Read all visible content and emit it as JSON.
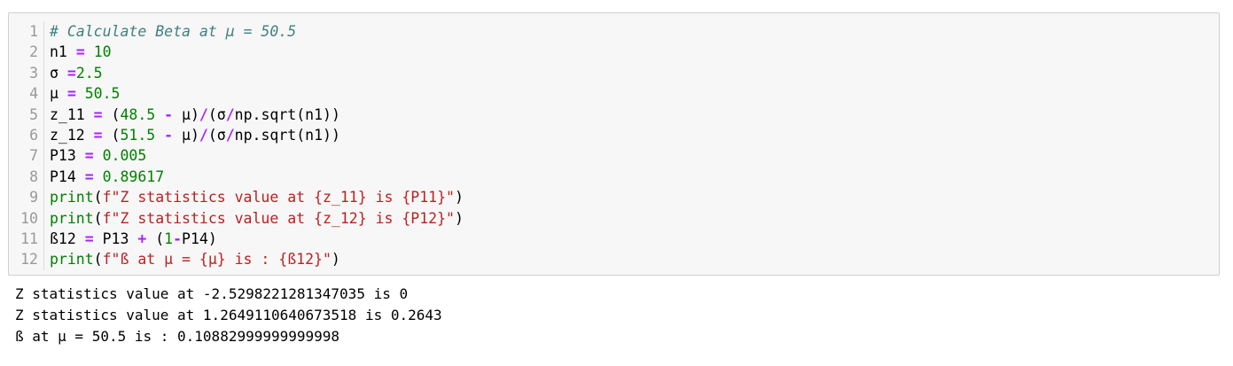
{
  "cell": {
    "lines": [
      {
        "n": "1",
        "tokens": [
          {
            "t": "# Calculate Beta at μ = 50.5",
            "k": "comment"
          }
        ]
      },
      {
        "n": "2",
        "tokens": [
          {
            "t": "n1 ",
            "k": "var"
          },
          {
            "t": "=",
            "k": "op"
          },
          {
            "t": " ",
            "k": "var"
          },
          {
            "t": "10",
            "k": "num"
          }
        ]
      },
      {
        "n": "3",
        "tokens": [
          {
            "t": "σ ",
            "k": "var"
          },
          {
            "t": "=",
            "k": "op"
          },
          {
            "t": "2.5",
            "k": "num"
          }
        ]
      },
      {
        "n": "4",
        "tokens": [
          {
            "t": "μ ",
            "k": "var"
          },
          {
            "t": "=",
            "k": "op"
          },
          {
            "t": " ",
            "k": "var"
          },
          {
            "t": "50.5",
            "k": "num"
          }
        ]
      },
      {
        "n": "5",
        "tokens": [
          {
            "t": "z_11 ",
            "k": "var"
          },
          {
            "t": "=",
            "k": "op"
          },
          {
            "t": " (",
            "k": "var"
          },
          {
            "t": "48.5",
            "k": "num"
          },
          {
            "t": " ",
            "k": "var"
          },
          {
            "t": "-",
            "k": "op"
          },
          {
            "t": " μ)",
            "k": "var"
          },
          {
            "t": "/",
            "k": "op"
          },
          {
            "t": "(σ",
            "k": "var"
          },
          {
            "t": "/",
            "k": "op"
          },
          {
            "t": "np",
            "k": "var"
          },
          {
            "t": ".",
            "k": "var"
          },
          {
            "t": "sqrt(n1))",
            "k": "var"
          }
        ]
      },
      {
        "n": "6",
        "tokens": [
          {
            "t": "z_12 ",
            "k": "var"
          },
          {
            "t": "=",
            "k": "op"
          },
          {
            "t": " (",
            "k": "var"
          },
          {
            "t": "51.5",
            "k": "num"
          },
          {
            "t": " ",
            "k": "var"
          },
          {
            "t": "-",
            "k": "op"
          },
          {
            "t": " μ)",
            "k": "var"
          },
          {
            "t": "/",
            "k": "op"
          },
          {
            "t": "(σ",
            "k": "var"
          },
          {
            "t": "/",
            "k": "op"
          },
          {
            "t": "np",
            "k": "var"
          },
          {
            "t": ".",
            "k": "var"
          },
          {
            "t": "sqrt(n1))",
            "k": "var"
          }
        ]
      },
      {
        "n": "7",
        "tokens": [
          {
            "t": "P13 ",
            "k": "var"
          },
          {
            "t": "=",
            "k": "op"
          },
          {
            "t": " ",
            "k": "var"
          },
          {
            "t": "0.005",
            "k": "num"
          }
        ]
      },
      {
        "n": "8",
        "tokens": [
          {
            "t": "P14 ",
            "k": "var"
          },
          {
            "t": "=",
            "k": "op"
          },
          {
            "t": " ",
            "k": "var"
          },
          {
            "t": "0.89617",
            "k": "num"
          }
        ]
      },
      {
        "n": "9",
        "tokens": [
          {
            "t": "print",
            "k": "builtin"
          },
          {
            "t": "(",
            "k": "var"
          },
          {
            "t": "f\"Z statistics value at {z_11} is {P11}\"",
            "k": "str"
          },
          {
            "t": ")",
            "k": "var"
          }
        ]
      },
      {
        "n": "10",
        "tokens": [
          {
            "t": "print",
            "k": "builtin"
          },
          {
            "t": "(",
            "k": "var"
          },
          {
            "t": "f\"Z statistics value at {z_12} is {P12}\"",
            "k": "str"
          },
          {
            "t": ")",
            "k": "var"
          }
        ]
      },
      {
        "n": "11",
        "tokens": [
          {
            "t": "ß12 ",
            "k": "var"
          },
          {
            "t": "=",
            "k": "op"
          },
          {
            "t": " P13 ",
            "k": "var"
          },
          {
            "t": "+",
            "k": "op"
          },
          {
            "t": " (",
            "k": "var"
          },
          {
            "t": "1",
            "k": "num"
          },
          {
            "t": "-",
            "k": "op"
          },
          {
            "t": "P14)",
            "k": "var"
          }
        ]
      },
      {
        "n": "12",
        "tokens": [
          {
            "t": "print",
            "k": "builtin"
          },
          {
            "t": "(",
            "k": "var"
          },
          {
            "t": "f\"ß at μ = {μ} is : {ß12}\"",
            "k": "str"
          },
          {
            "t": ")",
            "k": "var"
          }
        ]
      }
    ]
  },
  "output": {
    "lines": [
      "Z statistics value at -2.5298221281347035 is 0",
      "Z statistics value at 1.2649110640673518 is 0.2643",
      "ß at μ = 50.5 is : 0.10882999999999998"
    ]
  },
  "colors": {
    "comment": "#408080",
    "operator": "#aa22ff",
    "number": "#008000",
    "string": "#ba2121",
    "builtin": "#008000",
    "cell_background": "#f7f7f7"
  }
}
